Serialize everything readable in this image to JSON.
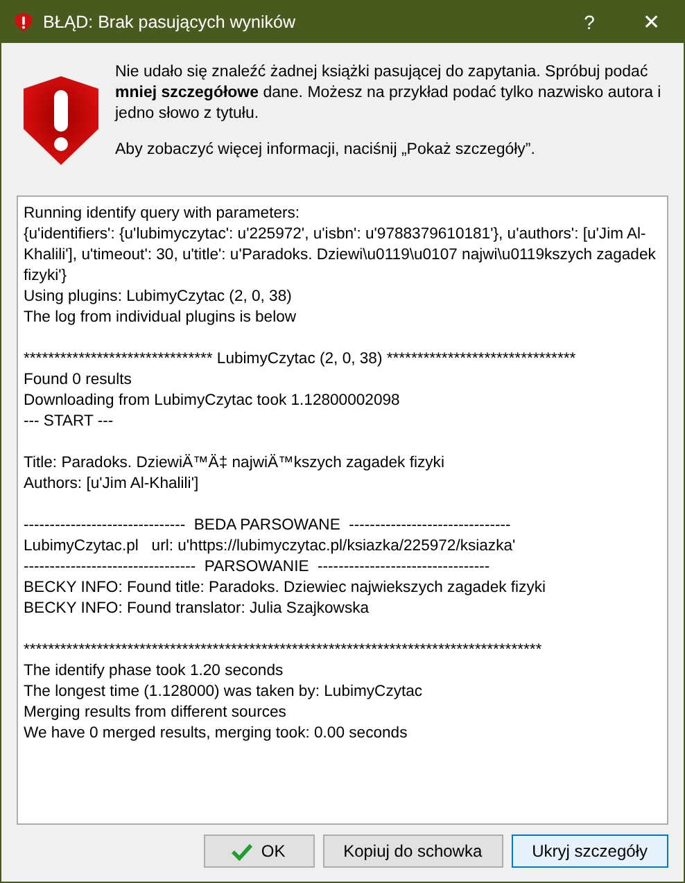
{
  "window": {
    "title": "BŁĄD: Brak pasujących wyników",
    "help": "?",
    "close": "✕"
  },
  "message": {
    "text": "Nie udało się znaleźć żadnej książki pasującej do zapytania. Spróbuj podać **mniej szczegółowe** dane. Możesz na przykład podać tylko nazwisko autora i jedno słowo z tytułu.",
    "hint": "Aby zobaczyć więcej informacji, naciśnij „Pokaż szczegóły”."
  },
  "log": [
    [
      "Running identify query with parameters:",
      "{u'identifiers': {u'lubimyczytac': u'225972', u'isbn': u'9788379610181'}, u'authors': [u'Jim Al-Khalili'], u'timeout': 30, u'title': u'Paradoks. Dziewi\\u0119\\u0107 najwi\\u0119kszych zagadek fizyki'}",
      "Using plugins: LubimyCzytac (2, 0, 38)",
      "The log from individual plugins is below"
    ],
    [
      "******************************* LubimyCzytac (2, 0, 38) *******************************",
      "Found 0 results",
      "Downloading from LubimyCzytac took 1.12800002098",
      "--- START ---"
    ],
    [
      "Title: Paradoks. DziewiÄ™Ä‡ najwiÄ™kszych zagadek fizyki",
      "Authors: [u'Jim Al-Khalili']"
    ],
    [
      "-------------------------------  BEDA PARSOWANE  -------------------------------",
      "LubimyCzytac.pl   url: u'https://lubimyczytac.pl/ksiazka/225972/ksiazka'",
      "---------------------------------  PARSOWANIE  ---------------------------------",
      "BECKY INFO: Found title: Paradoks. Dziewiec najwiekszych zagadek fizyki",
      "BECKY INFO: Found translator: Julia Szajkowska"
    ],
    [
      "*************************************************************************************",
      "The identify phase took 1.20 seconds",
      "The longest time (1.128000) was taken by: LubimyCzytac",
      "Merging results from different sources",
      "We have 0 merged results, merging took: 0.00 seconds"
    ]
  ],
  "buttons": [
    {
      "label": "OK",
      "kind": "ok",
      "focused": false
    },
    {
      "label": "Kopiuj do schowka",
      "kind": "plain",
      "focused": false
    },
    {
      "label": "Ukryj szczegóły",
      "kind": "plain",
      "focused": true
    }
  ]
}
